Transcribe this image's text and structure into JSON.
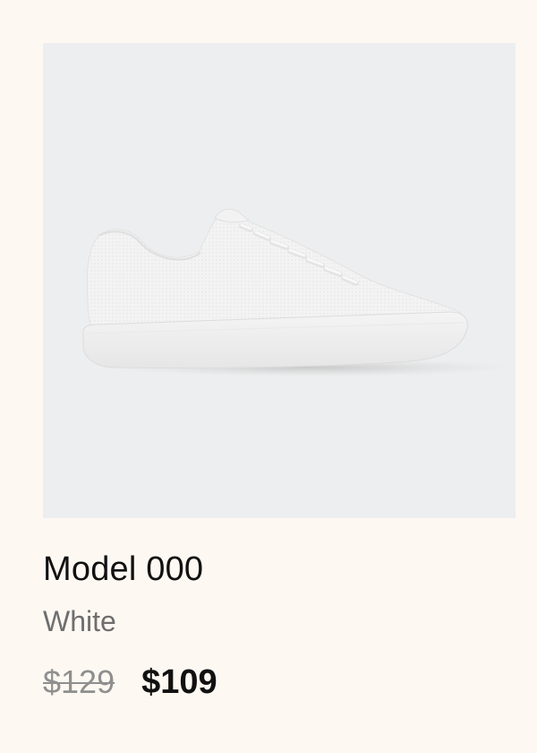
{
  "product": {
    "image_icon": "white-knit-sneaker",
    "name": "Model 000",
    "color": "White",
    "original_price": "$129",
    "sale_price": "$109"
  },
  "colors": {
    "background": "#fdf8f2",
    "image_background": "#edeeef",
    "text_primary": "#111111",
    "text_secondary": "#6e6e6e",
    "strikethrough_price": "#8f8f8f"
  }
}
